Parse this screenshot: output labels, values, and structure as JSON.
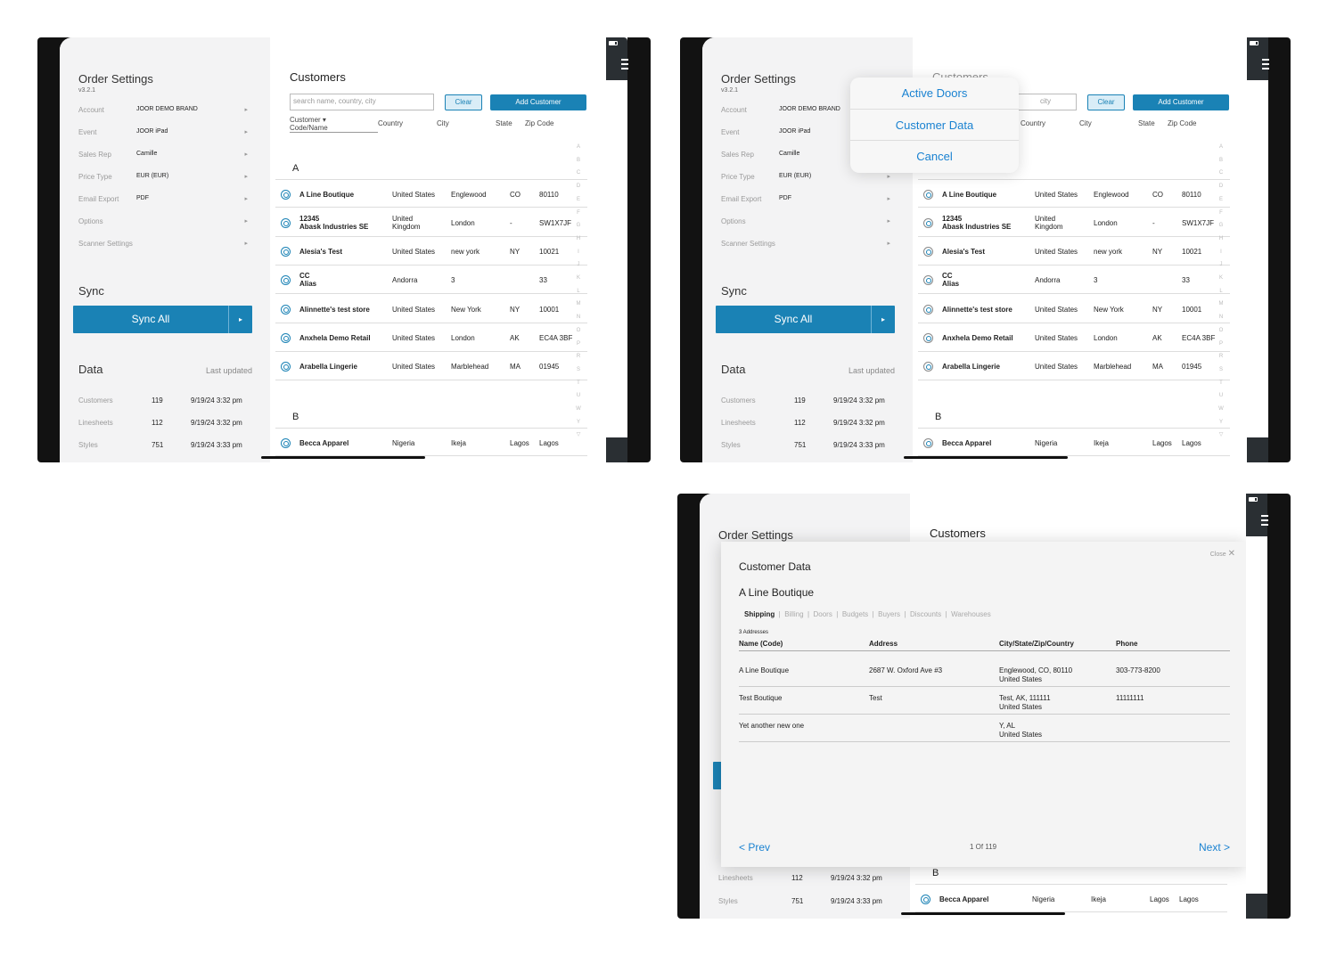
{
  "settings": {
    "title": "Order Settings",
    "version": "v3.2.1",
    "rows": [
      {
        "label": "Account",
        "value": "JOOR DEMO BRAND"
      },
      {
        "label": "Event",
        "value": "JOOR iPad"
      },
      {
        "label": "Sales Rep",
        "value": "Camille"
      },
      {
        "label": "Price Type",
        "value": "EUR (EUR)"
      },
      {
        "label": "Email Export",
        "value": "PDF"
      },
      {
        "label": "Options",
        "value": ""
      },
      {
        "label": "Scanner Settings",
        "value": ""
      }
    ],
    "chevron": "▸"
  },
  "sync": {
    "title": "Sync",
    "button": "Sync All",
    "arrow": "▸"
  },
  "data": {
    "title": "Data",
    "last_updated": "Last updated",
    "rows": [
      {
        "label": "Customers",
        "count": "119",
        "date": "9/19/24 3:32 pm"
      },
      {
        "label": "Linesheets",
        "count": "112",
        "date": "9/19/24 3:32 pm"
      },
      {
        "label": "Styles",
        "count": "751",
        "date": "9/19/24 3:33 pm"
      }
    ]
  },
  "customers": {
    "title": "Customers",
    "search_placeholder": "search name, country, city",
    "search_partial": "city",
    "clear": "Clear",
    "add": "Add Customer",
    "headers": {
      "code_a": "Customer",
      "code_b": "Code/Name",
      "country": "Country",
      "city": "City",
      "state": "State",
      "zip": "Zip Code"
    },
    "section_a": "A",
    "section_b": "B",
    "rows": [
      {
        "name": "A Line Boutique",
        "name2": "",
        "country": "United States",
        "country2": "",
        "city": "Englewood",
        "state": "CO",
        "zip": "80110"
      },
      {
        "name": "12345",
        "name2": "Abask Industries SE",
        "country": "United",
        "country2": "Kingdom",
        "city": "London",
        "state": "-",
        "zip": "SW1X7JF"
      },
      {
        "name": "Alesia's Test",
        "name2": "",
        "country": "United States",
        "country2": "",
        "city": "new york",
        "state": "NY",
        "zip": "10021"
      },
      {
        "name": "CC",
        "name2": "Alias",
        "country": "Andorra",
        "country2": "",
        "city": "3",
        "state": "",
        "zip": "33"
      },
      {
        "name": "Alinnette's test store",
        "name2": "",
        "country": "United States",
        "country2": "",
        "city": "New York",
        "state": "NY",
        "zip": "10001"
      },
      {
        "name": "Anxhela Demo Retail",
        "name2": "",
        "country": "United States",
        "country2": "",
        "city": "London",
        "state": "AK",
        "zip": "EC4A 3BF"
      },
      {
        "name": "Arabella Lingerie",
        "name2": "",
        "country": "United States",
        "country2": "",
        "city": "Marblehead",
        "state": "MA",
        "zip": "01945"
      }
    ],
    "row_b": {
      "name": "Becca Apparel",
      "country": "Nigeria",
      "city": "Ikeja",
      "state": "Lagos",
      "zip": "Lagos"
    },
    "alphabet": [
      "A",
      "B",
      "C",
      "D",
      "E",
      "F",
      "G",
      "H",
      "I",
      "J",
      "K",
      "L",
      "M",
      "N",
      "O",
      "P",
      "R",
      "S",
      "T",
      "U",
      "W",
      "Y",
      "▽"
    ]
  },
  "popover": {
    "items": [
      "Active Doors",
      "Customer Data",
      "Cancel"
    ]
  },
  "modal": {
    "close": "Close",
    "title": "Customer Data",
    "customer": "A Line Boutique",
    "tabs": [
      "Shipping",
      "Billing",
      "Doors",
      "Budgets",
      "Buyers",
      "Discounts",
      "Warehouses"
    ],
    "count": "3 Addresses",
    "columns": [
      "Name (Code)",
      "Address",
      "City/State/Zip/Country",
      "Phone"
    ],
    "rows": [
      {
        "name": "A Line Boutique",
        "address": "2687 W. Oxford Ave #3",
        "city": "Englewood, CO, 80110",
        "country": "United States",
        "phone": "303-773-8200"
      },
      {
        "name": "Test Boutique",
        "address": "Test",
        "city": "Test, AK, 111111",
        "country": "United States",
        "phone": "11111111"
      },
      {
        "name": "Yet another new one",
        "address": "",
        "city": "Y, AL",
        "country": "United States",
        "phone": ""
      }
    ],
    "prev": "< Prev",
    "pager": "1 Of 119",
    "next": "Next >"
  },
  "colors": {
    "accent": "#1a82b5",
    "link": "#1a82d1"
  }
}
